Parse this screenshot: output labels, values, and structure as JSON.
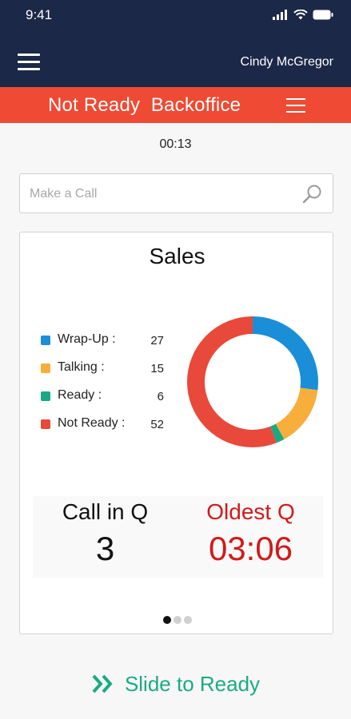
{
  "status_bar": {
    "time": "9:41"
  },
  "header": {
    "user_name": "Cindy McGregor"
  },
  "state_bar": {
    "label": "Not Ready  Backoffice"
  },
  "timer": "00:13",
  "search": {
    "placeholder": "Make a Call",
    "value": ""
  },
  "card": {
    "title": "Sales",
    "legend": [
      {
        "label": "Wrap-Up :",
        "value": "27",
        "color": "#1b8ed8"
      },
      {
        "label": "Talking :",
        "value": "15",
        "color": "#f7ae3a"
      },
      {
        "label": "Ready :",
        "value": "6",
        "color": "#1aa985"
      },
      {
        "label": "Not Ready :",
        "value": "52",
        "color": "#e8493a"
      }
    ],
    "donut_segments": [
      {
        "name": "Wrap-Up",
        "percent": 27,
        "color": "#1b8ed8"
      },
      {
        "name": "Talking",
        "percent": 15,
        "color": "#f7ae3a"
      },
      {
        "name": "Ready",
        "percent": 2,
        "color": "#1aa985"
      },
      {
        "name": "Not Ready",
        "percent": 56,
        "color": "#e8493a"
      }
    ],
    "call_in_q": {
      "label": "Call in Q",
      "value": "3"
    },
    "oldest_q": {
      "label": "Oldest Q",
      "value": "03:06"
    },
    "pagination": {
      "pages": 3,
      "active_index": 0
    }
  },
  "slide_action": {
    "label": "Slide to Ready",
    "color": "#1bab82"
  }
}
